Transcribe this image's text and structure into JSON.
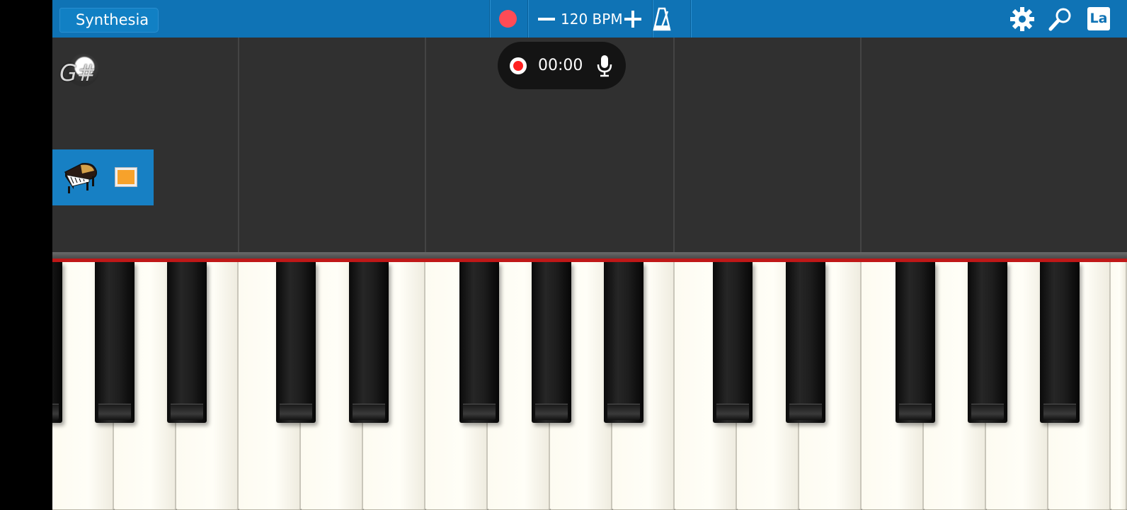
{
  "header": {
    "back_label": "Synthesia",
    "tempo_label": "120 BPM",
    "language_button": "La"
  },
  "icons": {
    "record": "record-circle-icon",
    "tempo_decrease": "minus-icon",
    "tempo_increase": "plus-icon",
    "metronome": "metronome-icon",
    "settings": "gear-icon",
    "search": "magnifier-icon",
    "microphone": "microphone-icon",
    "instrument": "grand-piano-icon"
  },
  "key_indicator": {
    "note": "G#"
  },
  "recorder": {
    "elapsed": "00:00"
  },
  "instrument": {
    "color": "#f7a22b"
  },
  "colors": {
    "top_bar": "#0f73b5",
    "track_background": "#303030",
    "record_red": "#ff4b56",
    "keyboard_accent": "#c01818"
  }
}
